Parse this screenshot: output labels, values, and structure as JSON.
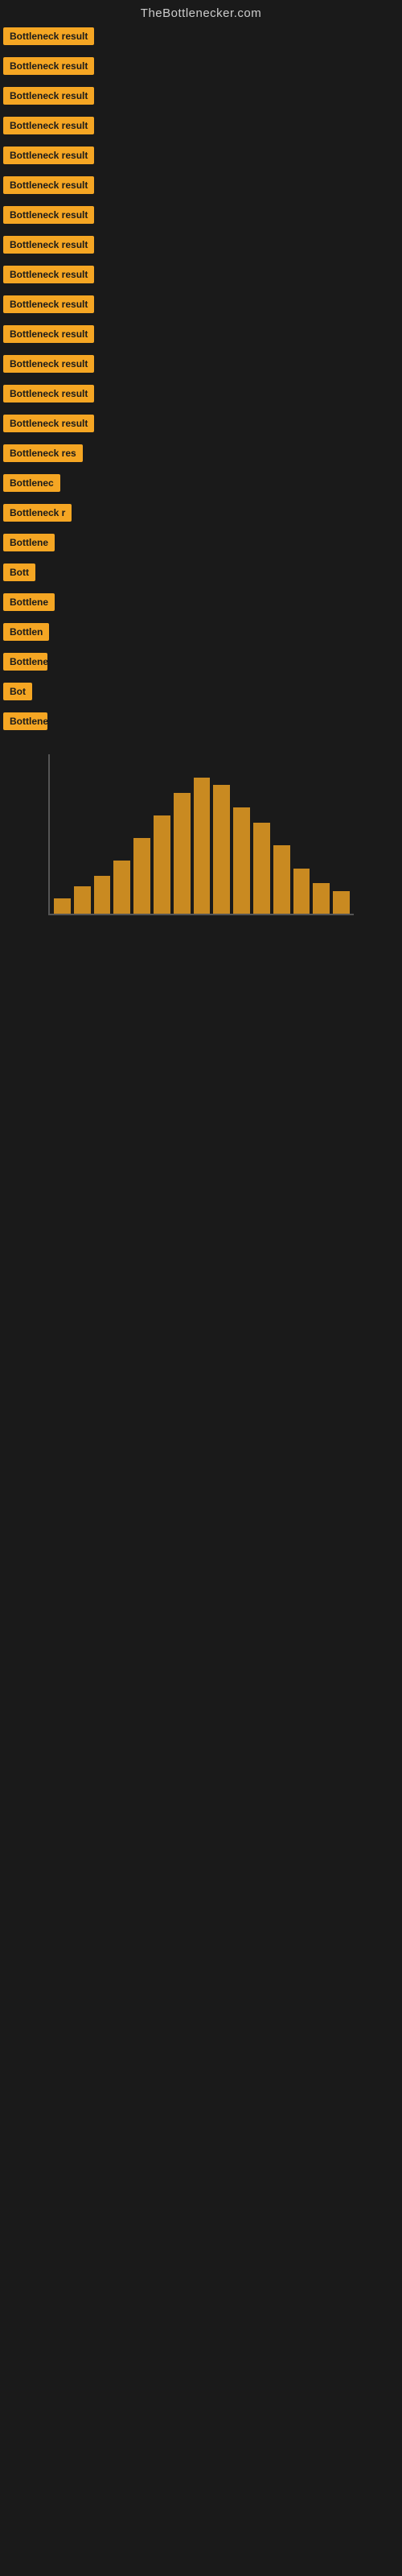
{
  "site": {
    "title": "TheBottlenecker.com"
  },
  "items": [
    {
      "label": "Bottleneck result",
      "clip": "clip-full"
    },
    {
      "label": "Bottleneck result",
      "clip": "clip-full"
    },
    {
      "label": "Bottleneck result",
      "clip": "clip-full"
    },
    {
      "label": "Bottleneck result",
      "clip": "clip-full"
    },
    {
      "label": "Bottleneck result",
      "clip": "clip-full"
    },
    {
      "label": "Bottleneck result",
      "clip": "clip-full"
    },
    {
      "label": "Bottleneck result",
      "clip": "clip-full"
    },
    {
      "label": "Bottleneck result",
      "clip": "clip-full"
    },
    {
      "label": "Bottleneck result",
      "clip": "clip-full"
    },
    {
      "label": "Bottleneck result",
      "clip": "clip-full"
    },
    {
      "label": "Bottleneck result",
      "clip": "clip-full"
    },
    {
      "label": "Bottleneck result",
      "clip": "clip-full"
    },
    {
      "label": "Bottleneck result",
      "clip": "clip-full"
    },
    {
      "label": "Bottleneck result",
      "clip": "clip-full"
    },
    {
      "label": "Bottleneck res",
      "clip": "clip-3"
    },
    {
      "label": "Bottlenec",
      "clip": "clip-4"
    },
    {
      "label": "Bottleneck r",
      "clip": "clip-5"
    },
    {
      "label": "Bottlene",
      "clip": "clip-6"
    },
    {
      "label": "Bott",
      "clip": "clip-7"
    },
    {
      "label": "Bottlene",
      "clip": "clip-8"
    },
    {
      "label": "Bottlen",
      "clip": "clip-9"
    },
    {
      "label": "Bottleneck",
      "clip": "clip-10"
    },
    {
      "label": "Bot",
      "clip": "clip-11"
    },
    {
      "label": "Bottlene",
      "clip": "clip-12"
    }
  ],
  "chart": {
    "bars": [
      10,
      18,
      25,
      35,
      50,
      65,
      80,
      90,
      85,
      70,
      60,
      45,
      30,
      20,
      15
    ],
    "bottom_label": "none"
  }
}
